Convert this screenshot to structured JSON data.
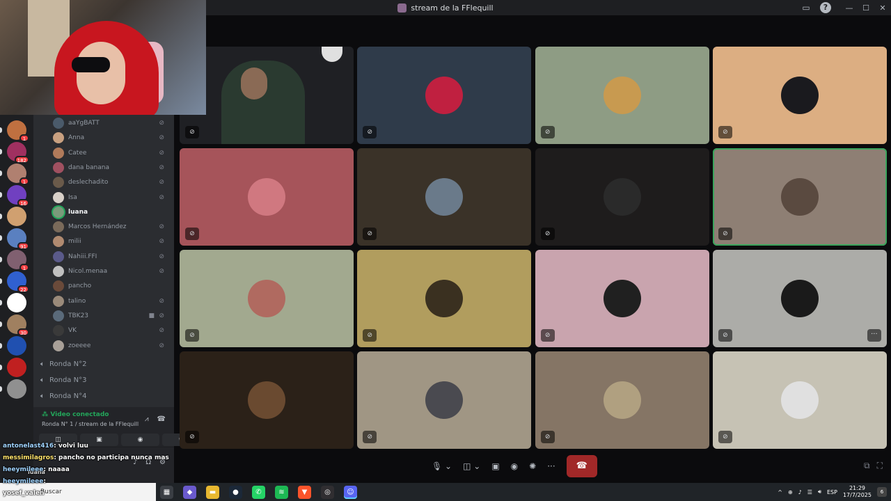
{
  "window": {
    "title": "stream de la FFlequill",
    "controls": [
      "—",
      "☐",
      "✕"
    ],
    "toolbar_icons": [
      "inbox-icon",
      "help-icon"
    ]
  },
  "colors": {
    "accent_green": "#23a55a",
    "hangup_red": "#a12828",
    "badge_red": "#f23f42"
  },
  "servers": [
    {
      "badge": "1"
    },
    {
      "badge": "182"
    },
    {
      "badge": "1"
    },
    {
      "badge": "16"
    },
    {
      "badge": ""
    },
    {
      "badge": "91"
    },
    {
      "badge": "1"
    },
    {
      "badge": "22"
    },
    {
      "badge": ""
    },
    {
      "badge": "30"
    },
    {
      "badge": ""
    },
    {
      "badge": ""
    },
    {
      "badge": ""
    }
  ],
  "members": [
    {
      "name": "aaYgBATT",
      "color": "#4a5a6a",
      "muted": true,
      "camera": false,
      "speaking": false
    },
    {
      "name": "Anna",
      "color": "#c8a080",
      "muted": true,
      "camera": false,
      "speaking": false
    },
    {
      "name": "Catee",
      "color": "#b07a5a",
      "muted": true,
      "camera": false,
      "speaking": false
    },
    {
      "name": "dana banana",
      "color": "#a05060",
      "muted": true,
      "camera": false,
      "speaking": false
    },
    {
      "name": "deslechadito",
      "color": "#6a5a4a",
      "muted": true,
      "camera": false,
      "speaking": false
    },
    {
      "name": "Isa",
      "color": "#d8d0c8",
      "muted": true,
      "camera": false,
      "speaking": false
    },
    {
      "name": "luana",
      "color": "#7a9a7a",
      "muted": false,
      "camera": false,
      "speaking": true
    },
    {
      "name": "Marcos Hernández",
      "color": "#7a6a5a",
      "muted": true,
      "camera": false,
      "speaking": false
    },
    {
      "name": "milii",
      "color": "#b08a70",
      "muted": true,
      "camera": false,
      "speaking": false
    },
    {
      "name": "Nahiii.FFI",
      "color": "#5a5a8a",
      "muted": true,
      "camera": false,
      "speaking": false
    },
    {
      "name": "Nicol.menaa",
      "color": "#c0c0c0",
      "muted": true,
      "camera": false,
      "speaking": false
    },
    {
      "name": "pancho",
      "color": "#6a4a3a",
      "muted": false,
      "camera": false,
      "speaking": false
    },
    {
      "name": "talino",
      "color": "#9a8a7a",
      "muted": true,
      "camera": false,
      "speaking": false
    },
    {
      "name": "TBK23",
      "color": "#5a6a7a",
      "muted": true,
      "camera": true,
      "speaking": false
    },
    {
      "name": "VK",
      "color": "#3a3a3a",
      "muted": true,
      "camera": false,
      "speaking": false
    },
    {
      "name": "zoeeee",
      "color": "#a8a098",
      "muted": true,
      "camera": false,
      "speaking": false
    }
  ],
  "voice_channels": [
    "Ronda N°2",
    "Ronda N°3",
    "Ronda N°4"
  ],
  "voice_panel": {
    "status": "Video conectado",
    "channel": "Ronda N° 1 / stream de la FFlequill"
  },
  "user": {
    "name": "luana"
  },
  "chat": [
    {
      "user": "antonelast416",
      "text": ": volvi luu"
    },
    {
      "user": "messimilagros",
      "text": ": pancho no participa nunca mas"
    },
    {
      "user": "heeymileee",
      "text": ": naaaa"
    },
    {
      "user": "heeymileee",
      "text": ":"
    },
    {
      "user": "yosef_valen",
      "text": ""
    }
  ],
  "tiles": [
    {
      "bg": "#1f2024",
      "avatar": "",
      "video": true,
      "speaking": false,
      "more": false
    },
    {
      "bg": "#2f3b4a",
      "avatar": "#c02040",
      "video": false,
      "speaking": false,
      "more": false
    },
    {
      "bg": "#8e9c84",
      "avatar": "#c89a50",
      "video": false,
      "speaking": false,
      "more": false
    },
    {
      "bg": "#dcae82",
      "avatar": "#1a1a1e",
      "video": false,
      "speaking": false,
      "more": false
    },
    {
      "bg": "#a6545a",
      "avatar": "#d07880",
      "video": false,
      "speaking": false,
      "more": false
    },
    {
      "bg": "#3a3228",
      "avatar": "#6a7a8a",
      "video": false,
      "speaking": false,
      "more": false
    },
    {
      "bg": "#1e1c1c",
      "avatar": "#2a2a2a",
      "video": false,
      "speaking": false,
      "more": false
    },
    {
      "bg": "#8e7f74",
      "avatar": "#5a4a40",
      "video": false,
      "speaking": true,
      "more": false
    },
    {
      "bg": "#a2a98f",
      "avatar": "#b06a60",
      "video": false,
      "speaking": false,
      "more": false
    },
    {
      "bg": "#b19d5e",
      "avatar": "#3a3020",
      "video": false,
      "speaking": false,
      "more": false
    },
    {
      "bg": "#c9a4ae",
      "avatar": "#202020",
      "video": false,
      "speaking": false,
      "more": false
    },
    {
      "bg": "#acaca8",
      "avatar": "#1a1a1a",
      "video": false,
      "speaking": false,
      "more": true
    },
    {
      "bg": "#2b2118",
      "avatar": "#6a4a30",
      "video": false,
      "speaking": false,
      "more": false
    },
    {
      "bg": "#a09684",
      "avatar": "#4a4a50",
      "video": false,
      "speaking": false,
      "more": false
    },
    {
      "bg": "#857565",
      "avatar": "#b0a080",
      "video": false,
      "speaking": false,
      "more": false
    },
    {
      "bg": "#c6c2b4",
      "avatar": "#e0e0e0",
      "video": false,
      "speaking": false,
      "more": false
    }
  ],
  "taskbar": {
    "search_placeholder": "Buscar",
    "time": "21:29",
    "date": "17/7/2025",
    "lang": "ESP",
    "notifications": "6",
    "apps": [
      {
        "name": "task-view-icon",
        "glyph": "▦",
        "color": "#3a3e44"
      },
      {
        "name": "copilot-icon",
        "glyph": "◆",
        "color": "#6a5acd"
      },
      {
        "name": "file-explorer-icon",
        "glyph": "▬",
        "color": "#e8b830"
      },
      {
        "name": "steam-icon",
        "glyph": "●",
        "color": "#1b2838"
      },
      {
        "name": "whatsapp-icon",
        "glyph": "✆",
        "color": "#25d366"
      },
      {
        "name": "spotify-icon",
        "glyph": "≋",
        "color": "#1db954"
      },
      {
        "name": "brave-icon",
        "glyph": "▼",
        "color": "#fb542b"
      },
      {
        "name": "obs-icon",
        "glyph": "◎",
        "color": "#302e31"
      },
      {
        "name": "discord-icon",
        "glyph": "☺",
        "color": "#5865f2"
      }
    ]
  }
}
